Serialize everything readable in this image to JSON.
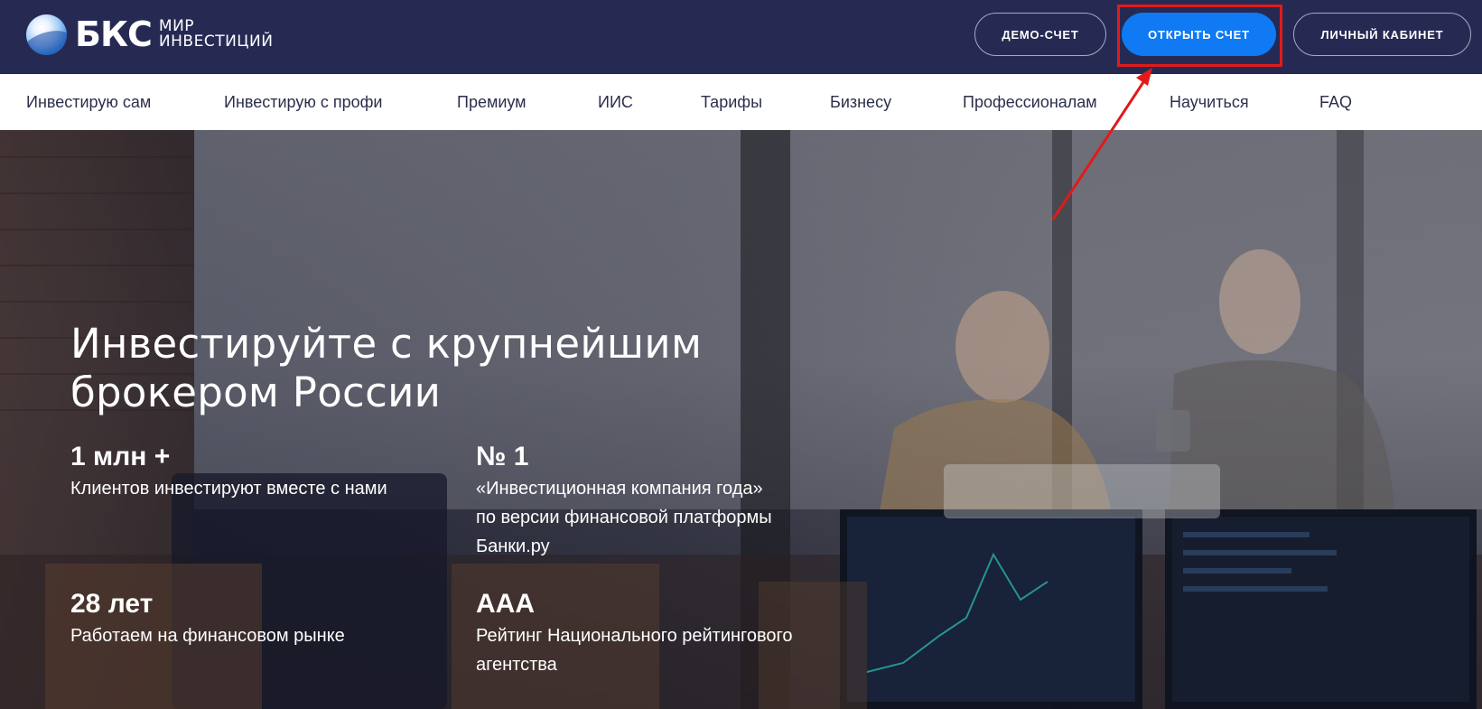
{
  "header": {
    "logo": {
      "brand": "БКС",
      "line1": "МИР",
      "line2": "ИНВЕСТИЦИЙ"
    },
    "buttons": {
      "demo": "ДЕМО-СЧЕТ",
      "open_account": "ОТКРЫТЬ СЧЕТ",
      "cabinet": "ЛИЧНЫЙ КАБИНЕТ"
    }
  },
  "nav": {
    "items": [
      {
        "label": "Инвестирую сам"
      },
      {
        "label": "Инвестирую с профи"
      },
      {
        "label": "Премиум"
      },
      {
        "label": "ИИС"
      },
      {
        "label": "Тарифы"
      },
      {
        "label": "Бизнесу"
      },
      {
        "label": "Профессионалам"
      },
      {
        "label": "Научиться"
      },
      {
        "label": "FAQ"
      }
    ]
  },
  "hero": {
    "title_line1": "Инвестируйте с крупнейшим",
    "title_line2": "брокером России",
    "stats": [
      {
        "value": "1 млн +",
        "desc_lines": [
          "Клиентов инвестируют вместе с нами"
        ]
      },
      {
        "value": "№ 1",
        "desc_lines": [
          "«Инвестиционная компания года»",
          "по версии финансовой платформы",
          "Банки.ру"
        ]
      },
      {
        "value": "28 лет",
        "desc_lines": [
          "Работаем на финансовом рынке"
        ]
      },
      {
        "value": "ААА",
        "desc_lines": [
          "Рейтинг Национального рейтингового",
          "агентства"
        ]
      }
    ]
  },
  "annotation": {
    "color": "#e11a1a"
  },
  "colors": {
    "header_bg": "#262a53",
    "primary_button": "#0f7af3",
    "nav_text": "#2b2f4a"
  }
}
